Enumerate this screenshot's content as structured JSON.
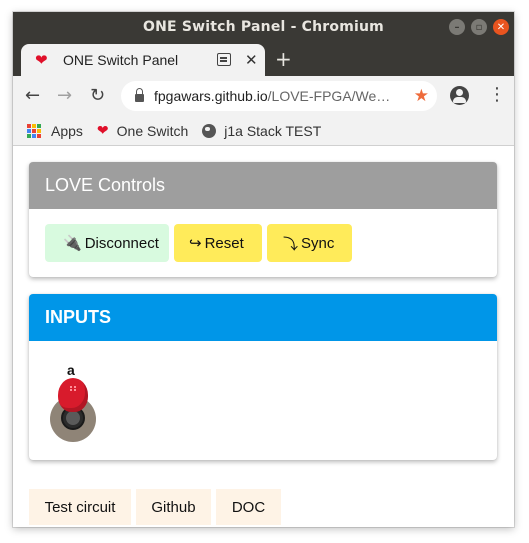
{
  "window": {
    "title": "ONE Switch Panel - Chromium"
  },
  "tab": {
    "title": "ONE Switch Panel",
    "close": "✕"
  },
  "newtab": "+",
  "nav": {
    "back": "←",
    "forward": "→",
    "reload": "↻",
    "menu": "⋮"
  },
  "omnibox": {
    "host": "fpgawars.github.io",
    "path": "/LOVE-FPGA/We…",
    "star": "★"
  },
  "bookmarks": [
    {
      "label": "Apps",
      "icon": "apps-grid-icon"
    },
    {
      "label": "One Switch",
      "icon": "heart-icon"
    },
    {
      "label": "j1a Stack TEST",
      "icon": "globe-icon"
    }
  ],
  "apps_grid_colors": [
    "#e94235",
    "#fbbc05",
    "#34a853",
    "#4285f4",
    "#e94235",
    "#fbbc05",
    "#34a853",
    "#4285f4",
    "#e94235"
  ],
  "controls": {
    "header": "LOVE Controls",
    "buttons": {
      "disconnect": {
        "glyph": "🔌",
        "label": "Disconnect"
      },
      "reset": {
        "glyph": "↪",
        "label": "Reset"
      },
      "sync": {
        "glyph": "⤵",
        "label": "Sync"
      }
    }
  },
  "inputs": {
    "header": "INPUTS",
    "switch_label": "a"
  },
  "footer": {
    "test": "Test circuit",
    "github": "Github",
    "doc": "DOC"
  },
  "colors": {
    "controls_header": "#9e9e9e",
    "inputs_header": "#0096e8",
    "disconnect_bg": "#d8fadf",
    "reset_sync_bg": "#ffeb5a",
    "footer_btn_bg": "#fef3e6",
    "switch_cap": "#d81b2c"
  }
}
